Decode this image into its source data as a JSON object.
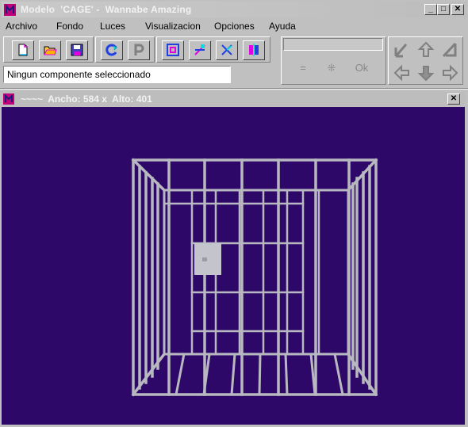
{
  "window": {
    "title": "Modelo  'CAGE' -  Wannabe Amazing",
    "buttons": {
      "minimize": "_",
      "maximize": "□",
      "close": "✕"
    }
  },
  "menu": [
    "Archivo",
    "Fondo",
    "Luces",
    "Visualizacion",
    "Opciones",
    "Ayuda"
  ],
  "toolbar": {
    "icons": [
      "new-file-icon",
      "open-folder-icon",
      "save-icon",
      "refresh-icon",
      "parking-icon",
      "frame-icon",
      "zoom-icon",
      "cut-icon",
      "flip-icon"
    ]
  },
  "status": {
    "text": "Ningun componente seleccionado"
  },
  "right_panel": {
    "input_value": "",
    "buttons": [
      "=",
      "⁜",
      "Ok"
    ]
  },
  "arrows": [
    "rotate-left-icon",
    "up-arrow-icon",
    "rotate-right-icon",
    "left-arrow-icon",
    "down-arrow-icon",
    "right-arrow-icon"
  ],
  "viewport": {
    "title": "~~~~  Ancho: 584 x  Alto: 401",
    "close": "✕",
    "background": "#2e0868"
  }
}
